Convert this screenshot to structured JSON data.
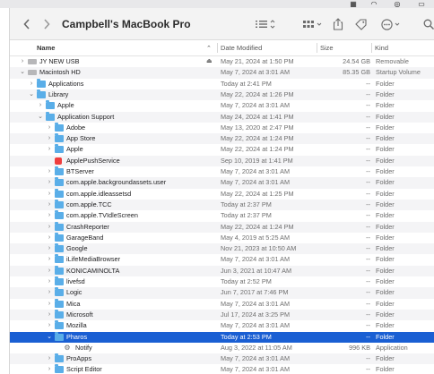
{
  "window": {
    "title": "Campbell's MacBook Pro"
  },
  "menubar": {
    "icons": [
      "control-center-icon",
      "wifi-icon",
      "siri-icon",
      "battery-icon"
    ]
  },
  "header": {
    "name": "Name",
    "date_modified": "Date Modified",
    "size": "Size",
    "kind": "Kind"
  },
  "rows": [
    {
      "name": "JY NEW USB",
      "date": "May 21, 2024 at 1:50 PM",
      "size": "24.54 GB",
      "kind": "Removable",
      "indent": 0,
      "icon": "drive",
      "disc": "closed",
      "eject": true
    },
    {
      "name": "Macintosh HD",
      "date": "May 7, 2024 at 3:01 AM",
      "size": "85.35 GB",
      "kind": "Startup Volume",
      "indent": 0,
      "icon": "drive",
      "disc": "open"
    },
    {
      "name": "Applications",
      "date": "Today at 2:41 PM",
      "size": "--",
      "kind": "Folder",
      "indent": 1,
      "icon": "folder",
      "disc": "closed"
    },
    {
      "name": "Library",
      "date": "May 22, 2024 at 1:26 PM",
      "size": "--",
      "kind": "Folder",
      "indent": 1,
      "icon": "folder",
      "disc": "open"
    },
    {
      "name": "Apple",
      "date": "May 7, 2024 at 3:01 AM",
      "size": "--",
      "kind": "Folder",
      "indent": 2,
      "icon": "folder",
      "disc": "closed"
    },
    {
      "name": "Application Support",
      "date": "May 24, 2024 at 1:41 PM",
      "size": "--",
      "kind": "Folder",
      "indent": 2,
      "icon": "folder",
      "disc": "open"
    },
    {
      "name": "Adobe",
      "date": "May 13, 2020 at 2:47 PM",
      "size": "--",
      "kind": "Folder",
      "indent": 3,
      "icon": "folder",
      "disc": "closed"
    },
    {
      "name": "App Store",
      "date": "May 22, 2024 at 1:24 PM",
      "size": "--",
      "kind": "Folder",
      "indent": 3,
      "icon": "folder",
      "disc": "closed"
    },
    {
      "name": "Apple",
      "date": "May 22, 2024 at 1:24 PM",
      "size": "--",
      "kind": "Folder",
      "indent": 3,
      "icon": "folder",
      "disc": "closed"
    },
    {
      "name": "ApplePushService",
      "date": "Sep 10, 2019 at 1:41 PM",
      "size": "--",
      "kind": "Folder",
      "indent": 3,
      "icon": "app",
      "disc": "none"
    },
    {
      "name": "BTServer",
      "date": "May 7, 2024 at 3:01 AM",
      "size": "--",
      "kind": "Folder",
      "indent": 3,
      "icon": "folder",
      "disc": "closed"
    },
    {
      "name": "com.apple.backgroundassets.user",
      "date": "May 7, 2024 at 3:01 AM",
      "size": "--",
      "kind": "Folder",
      "indent": 3,
      "icon": "folder",
      "disc": "closed"
    },
    {
      "name": "com.apple.idleassetsd",
      "date": "May 22, 2024 at 1:25 PM",
      "size": "--",
      "kind": "Folder",
      "indent": 3,
      "icon": "folder",
      "disc": "closed"
    },
    {
      "name": "com.apple.TCC",
      "date": "Today at 2:37 PM",
      "size": "--",
      "kind": "Folder",
      "indent": 3,
      "icon": "folder",
      "disc": "closed"
    },
    {
      "name": "com.apple.TVIdleScreen",
      "date": "Today at 2:37 PM",
      "size": "--",
      "kind": "Folder",
      "indent": 3,
      "icon": "folder",
      "disc": "closed"
    },
    {
      "name": "CrashReporter",
      "date": "May 22, 2024 at 1:24 PM",
      "size": "--",
      "kind": "Folder",
      "indent": 3,
      "icon": "folder",
      "disc": "closed"
    },
    {
      "name": "GarageBand",
      "date": "May 4, 2019 at 5:25 AM",
      "size": "--",
      "kind": "Folder",
      "indent": 3,
      "icon": "folder",
      "disc": "closed"
    },
    {
      "name": "Google",
      "date": "Nov 21, 2023 at 10:50 AM",
      "size": "--",
      "kind": "Folder",
      "indent": 3,
      "icon": "folder",
      "disc": "closed"
    },
    {
      "name": "iLifeMediaBrowser",
      "date": "May 7, 2024 at 3:01 AM",
      "size": "--",
      "kind": "Folder",
      "indent": 3,
      "icon": "folder",
      "disc": "closed"
    },
    {
      "name": "KONICAMINOLTA",
      "date": "Jun 3, 2021 at 10:47 AM",
      "size": "--",
      "kind": "Folder",
      "indent": 3,
      "icon": "folder",
      "disc": "closed"
    },
    {
      "name": "livefsd",
      "date": "Today at 2:52 PM",
      "size": "--",
      "kind": "Folder",
      "indent": 3,
      "icon": "folder",
      "disc": "closed"
    },
    {
      "name": "Logic",
      "date": "Jun 7, 2017 at 7:46 PM",
      "size": "--",
      "kind": "Folder",
      "indent": 3,
      "icon": "folder",
      "disc": "closed"
    },
    {
      "name": "Mica",
      "date": "May 7, 2024 at 3:01 AM",
      "size": "--",
      "kind": "Folder",
      "indent": 3,
      "icon": "folder",
      "disc": "closed"
    },
    {
      "name": "Microsoft",
      "date": "Jul 17, 2024 at 3:25 PM",
      "size": "--",
      "kind": "Folder",
      "indent": 3,
      "icon": "folder",
      "disc": "closed"
    },
    {
      "name": "Mozilla",
      "date": "May 7, 2024 at 3:01 AM",
      "size": "--",
      "kind": "Folder",
      "indent": 3,
      "icon": "folder",
      "disc": "closed"
    },
    {
      "name": "Pharos",
      "date": "Today at 2:53 PM",
      "size": "--",
      "kind": "Folder",
      "indent": 3,
      "icon": "folder",
      "disc": "open",
      "selected": true
    },
    {
      "name": "Notify",
      "date": "Aug 3, 2022 at 11:05 AM",
      "size": "996 KB",
      "kind": "Application",
      "indent": 4,
      "icon": "gear",
      "disc": "none"
    },
    {
      "name": "ProApps",
      "date": "May 7, 2024 at 3:01 AM",
      "size": "--",
      "kind": "Folder",
      "indent": 3,
      "icon": "folder",
      "disc": "closed"
    },
    {
      "name": "Script Editor",
      "date": "May 7, 2024 at 3:01 AM",
      "size": "--",
      "kind": "Folder",
      "indent": 3,
      "icon": "folder",
      "disc": "closed"
    }
  ]
}
